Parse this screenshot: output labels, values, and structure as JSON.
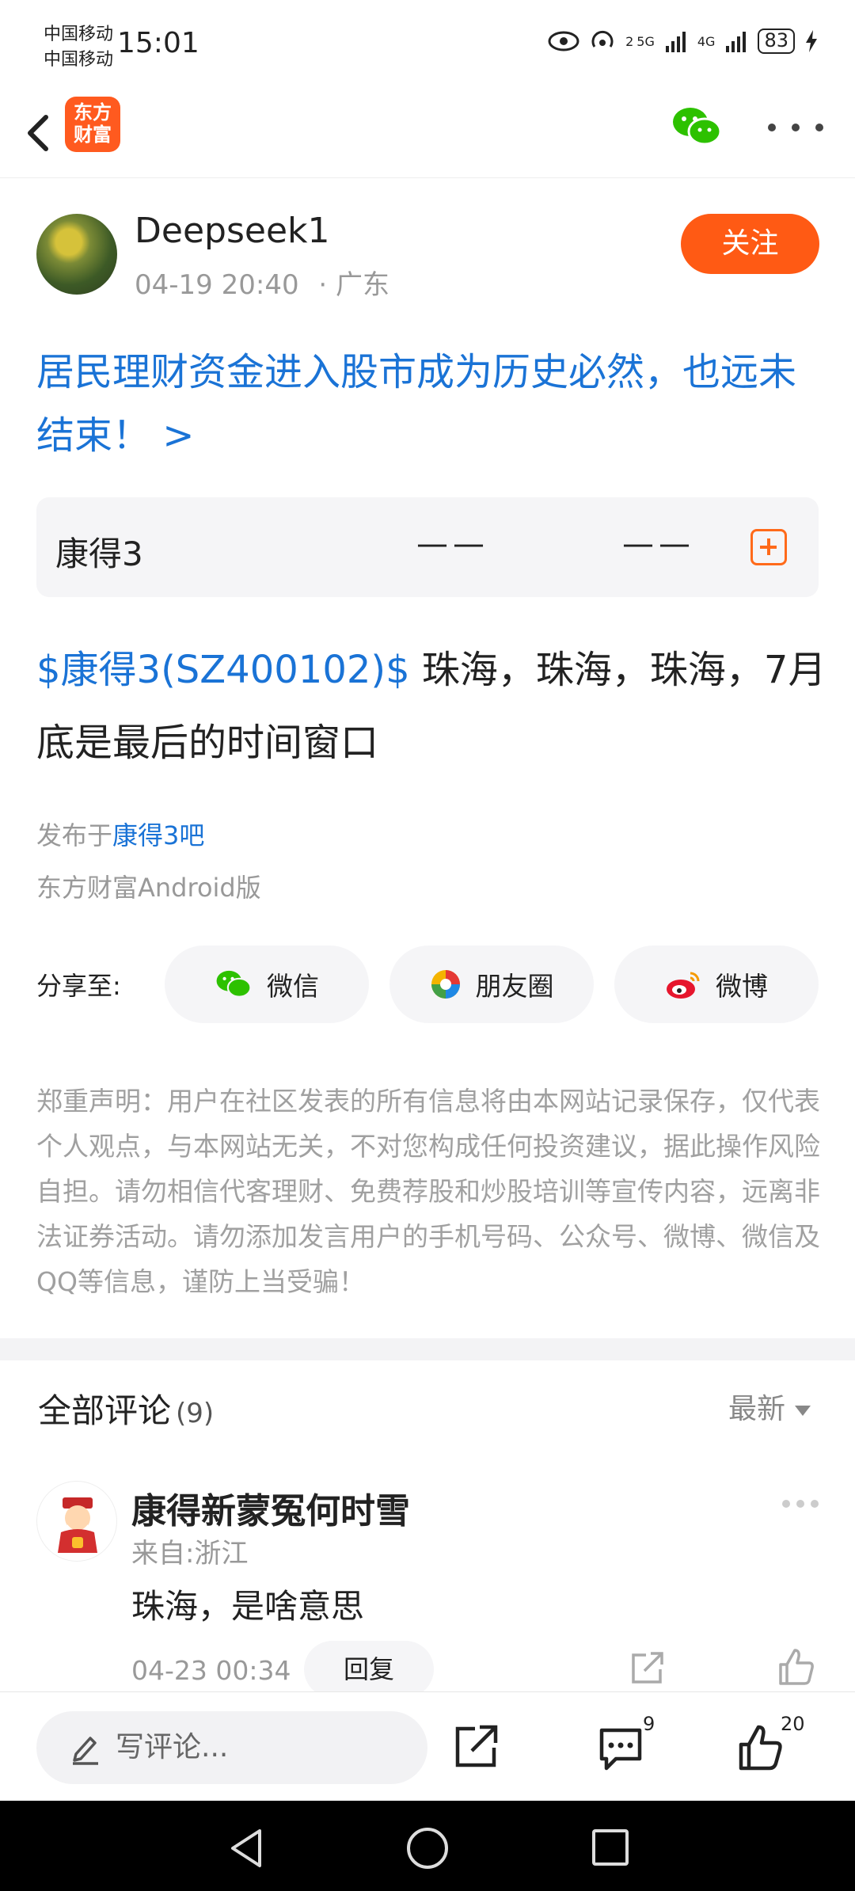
{
  "status_bar": {
    "carrier_1": "中国移动",
    "carrier_2": "中国移动",
    "time": "15:01",
    "net_1": "5G",
    "net_2": "4G",
    "sim_1": "2",
    "battery": "83"
  },
  "app_bar": {
    "logo_text": "东方财富"
  },
  "author": {
    "name": "Deepseek1",
    "datetime": "04-19 20:40",
    "location": "· 广东",
    "follow_label": "关注"
  },
  "post": {
    "title": "居民理财资金进入股市成为历史必然，也远未结束！ >",
    "stock": {
      "name": "康得3",
      "value_1": "——",
      "value_2": "——"
    },
    "body_tag": "$康得3(SZ400102)$",
    "body_text": " 珠海，珠海，珠海，7月底是最后的时间窗口",
    "posted_in_prefix": "发布于",
    "posted_in_bar": "康得3吧",
    "client": "东方财富Android版"
  },
  "share": {
    "label": "分享至:",
    "wechat": "微信",
    "moments": "朋友圈",
    "weibo": "微博"
  },
  "disclaimer": "郑重声明：用户在社区发表的所有信息将由本网站记录保存，仅代表个人观点，与本网站无关，不对您构成任何投资建议，据此操作风险自担。请勿相信代客理财、免费荐股和炒股培训等宣传内容，远离非法证券活动。请勿添加发言用户的手机号码、公众号、微博、微信及QQ等信息，谨防上当受骗！",
  "comments": {
    "title": "全部评论",
    "count": "(9)",
    "sort": "最新",
    "items": [
      {
        "name": "康得新蒙冤何时雪",
        "from": "来自:浙江",
        "text": "珠海，是啥意思",
        "date": "04-23 00:34",
        "reply_label": "回复"
      }
    ]
  },
  "toolbar": {
    "input_placeholder": "写评论...",
    "comments_badge": "9",
    "likes_badge": "20"
  },
  "colors": {
    "brand_orange": "#ff5a14",
    "link_blue": "#1a73d6"
  }
}
